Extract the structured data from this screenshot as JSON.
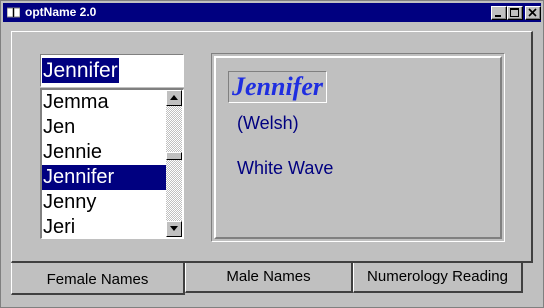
{
  "window": {
    "title": "optName 2.0",
    "icon": "book-icon"
  },
  "name_input": {
    "value": "Jennifer"
  },
  "name_list": {
    "items": [
      "Jemma",
      "Jen",
      "Jennie",
      "Jennifer",
      "Jenny",
      "Jeri"
    ],
    "selected": "Jennifer"
  },
  "detail": {
    "name": "Jennifer",
    "origin": "(Welsh)",
    "meaning": "White Wave"
  },
  "tabs": [
    {
      "label": "Female Names",
      "active": true
    },
    {
      "label": "Male Names",
      "active": false
    },
    {
      "label": "Numerology Reading",
      "active": false
    }
  ],
  "colors": {
    "titlebar": "#000080",
    "selection": "#000080",
    "detail_name": "#1f2ee0",
    "detail_text": "#000080",
    "face": "#c0c0c0"
  }
}
